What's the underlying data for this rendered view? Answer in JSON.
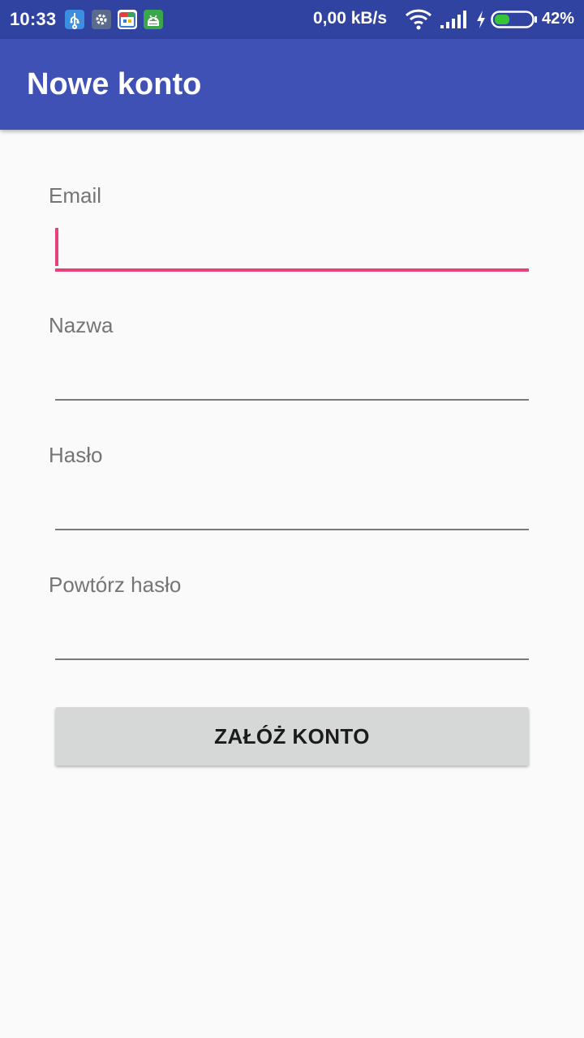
{
  "status_bar": {
    "time": "10:33",
    "network_speed": "0,00 kB/s",
    "battery_percent": "42%",
    "battery_level": 0.42,
    "icons": [
      "usb-icon",
      "settings-notification-icon",
      "calendar-notification-icon",
      "android-notification-icon",
      "wifi-icon",
      "signal-icon",
      "charging-icon",
      "battery-icon"
    ]
  },
  "app_bar": {
    "title": "Nowe konto"
  },
  "form": {
    "email": {
      "label": "Email",
      "value": ""
    },
    "name": {
      "label": "Nazwa",
      "value": ""
    },
    "password": {
      "label": "Hasło",
      "value": ""
    },
    "repeat_password": {
      "label": "Powtórz hasło",
      "value": ""
    },
    "submit_label": "ZAŁÓŻ KONTO"
  },
  "colors": {
    "status_bar": "#3143a0",
    "app_bar": "#3f51b5",
    "accent": "#ea407a",
    "background": "#fafafa",
    "button": "#d6d7d7"
  }
}
